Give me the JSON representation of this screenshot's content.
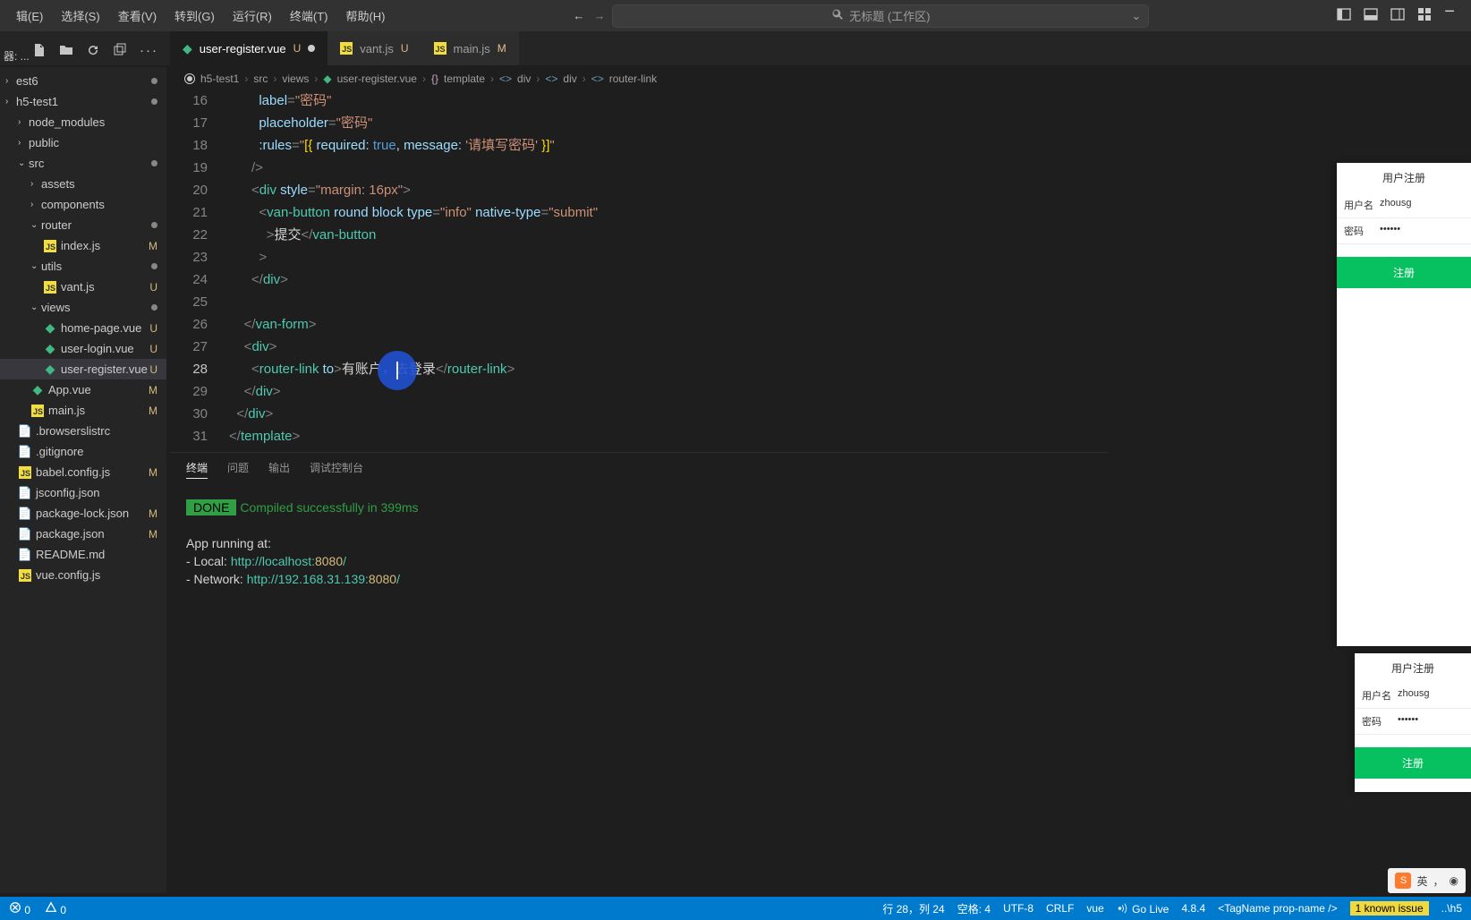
{
  "menubar": {
    "items": [
      "辑(E)",
      "选择(S)",
      "查看(V)",
      "转到(G)",
      "运行(R)",
      "终端(T)",
      "帮助(H)"
    ]
  },
  "search": {
    "label": "无标题 (工作区)"
  },
  "tabs": [
    {
      "icon": "vue",
      "name": "user-register.vue",
      "badge": "U",
      "dirty": true,
      "active": true
    },
    {
      "icon": "js",
      "name": "vant.js",
      "badge": "U",
      "dirty": false,
      "active": false
    },
    {
      "icon": "js",
      "name": "main.js",
      "badge": "M",
      "dirty": false,
      "active": false
    }
  ],
  "side_toolbar_label": "器: ...",
  "breadcrumb": {
    "items": [
      "h5-test1",
      "src",
      "views",
      "user-register.vue",
      "template",
      "div",
      "div",
      "router-link"
    ]
  },
  "tree": [
    {
      "depth": 0,
      "kind": "chev",
      "name": "est6",
      "badge": "dot"
    },
    {
      "depth": 0,
      "kind": "chev",
      "name": "h5-test1",
      "badge": "dot"
    },
    {
      "depth": 1,
      "kind": "chev",
      "name": "node_modules"
    },
    {
      "depth": 1,
      "kind": "chev",
      "name": "public"
    },
    {
      "depth": 1,
      "kind": "chev-open",
      "name": "src",
      "badge": "dot"
    },
    {
      "depth": 2,
      "kind": "chev",
      "name": "assets"
    },
    {
      "depth": 2,
      "kind": "chev",
      "name": "components"
    },
    {
      "depth": 2,
      "kind": "chev-open",
      "name": "router",
      "badge": "dot"
    },
    {
      "depth": 3,
      "kind": "js",
      "name": "index.js",
      "badge": "M"
    },
    {
      "depth": 2,
      "kind": "chev-open",
      "name": "utils",
      "badge": "dot"
    },
    {
      "depth": 3,
      "kind": "js",
      "name": "vant.js",
      "badge": "U"
    },
    {
      "depth": 2,
      "kind": "chev-open",
      "name": "views",
      "badge": "dot"
    },
    {
      "depth": 3,
      "kind": "vue",
      "name": "home-page.vue",
      "badge": "U"
    },
    {
      "depth": 3,
      "kind": "vue",
      "name": "user-login.vue",
      "badge": "U"
    },
    {
      "depth": 3,
      "kind": "vue",
      "name": "user-register.vue",
      "badge": "U",
      "sel": true
    },
    {
      "depth": 2,
      "kind": "vue",
      "name": "App.vue",
      "badge": "M"
    },
    {
      "depth": 2,
      "kind": "js",
      "name": "main.js",
      "badge": "M"
    },
    {
      "depth": 1,
      "kind": "file",
      "name": ".browserslistrc"
    },
    {
      "depth": 1,
      "kind": "file",
      "name": ".gitignore"
    },
    {
      "depth": 1,
      "kind": "js",
      "name": "babel.config.js",
      "badge": "M"
    },
    {
      "depth": 1,
      "kind": "file",
      "name": "jsconfig.json"
    },
    {
      "depth": 1,
      "kind": "file",
      "name": "package-lock.json",
      "badge": "M"
    },
    {
      "depth": 1,
      "kind": "file",
      "name": "package.json",
      "badge": "M"
    },
    {
      "depth": 1,
      "kind": "file",
      "name": "README.md"
    },
    {
      "depth": 1,
      "kind": "js",
      "name": "vue.config.js"
    }
  ],
  "editor": {
    "first_line": 16,
    "active_line": 28,
    "lines": [
      {
        "n": 16,
        "html": "        <span class='tok-attr'>label</span><span class='tok-punct'>=</span><span class='tok-str'>\"密码\"</span>"
      },
      {
        "n": 17,
        "html": "        <span class='tok-attr'>placeholder</span><span class='tok-punct'>=</span><span class='tok-str'>\"密码\"</span>"
      },
      {
        "n": 18,
        "html": "        <span class='tok-attr'>:rules</span><span class='tok-punct'>=</span><span class='tok-str'>\"</span><span class='tok-brace'>[{</span> <span class='tok-attr'>required:</span> <span class='tok-bool'>true</span><span class='tok-text'>,</span> <span class='tok-attr'>message:</span> <span class='tok-str'>'请填写密码'</span> <span class='tok-brace'>}]</span><span class='tok-str'>\"</span>"
      },
      {
        "n": 19,
        "html": "      <span class='tok-punct'>/&gt;</span>"
      },
      {
        "n": 20,
        "html": "      <span class='tok-punct'>&lt;</span><span class='tok-tag'>div</span> <span class='tok-attr'>style</span><span class='tok-punct'>=</span><span class='tok-str'>\"margin: 16px\"</span><span class='tok-punct'>&gt;</span>"
      },
      {
        "n": 21,
        "html": "        <span class='tok-punct'>&lt;</span><span class='tok-tag'>van-button</span> <span class='tok-attr'>round</span> <span class='tok-attr'>block</span> <span class='tok-attr'>type</span><span class='tok-punct'>=</span><span class='tok-str'>\"info\"</span> <span class='tok-attr'>native-type</span><span class='tok-punct'>=</span><span class='tok-str'>\"submit\"</span>"
      },
      {
        "n": 22,
        "html": "          <span class='tok-punct'>&gt;</span><span class='tok-text'>提交</span><span class='tok-punct'>&lt;/</span><span class='tok-tag'>van-button</span>"
      },
      {
        "n": 23,
        "html": "        <span class='tok-punct'>&gt;</span>"
      },
      {
        "n": 24,
        "html": "      <span class='tok-punct'>&lt;/</span><span class='tok-tag'>div</span><span class='tok-punct'>&gt;</span>"
      },
      {
        "n": 25,
        "html": ""
      },
      {
        "n": 26,
        "html": "    <span class='tok-punct'>&lt;/</span><span class='tok-tag'>van-form</span><span class='tok-punct'>&gt;</span>"
      },
      {
        "n": 27,
        "html": "    <span class='tok-punct'>&lt;</span><span class='tok-tag'>div</span><span class='tok-punct'>&gt;</span>"
      },
      {
        "n": 28,
        "html": "      <span class='tok-punct'>&lt;</span><span class='tok-tag'>router-link</span> <span class='tok-attr'>to</span><span class='tok-punct'>&gt;</span><span class='tok-text'>有账户，去登录</span><span class='tok-punct'>&lt;/</span><span class='tok-tag'>router-link</span><span class='tok-punct'>&gt;</span>"
      },
      {
        "n": 29,
        "html": "    <span class='tok-punct'>&lt;/</span><span class='tok-tag'>div</span><span class='tok-punct'>&gt;</span>"
      },
      {
        "n": 30,
        "html": "  <span class='tok-punct'>&lt;/</span><span class='tok-tag'>div</span><span class='tok-punct'>&gt;</span>"
      },
      {
        "n": 31,
        "html": "<span class='tok-punct'>&lt;/</span><span class='tok-tag'>template</span><span class='tok-punct'>&gt;</span>"
      }
    ]
  },
  "panel": {
    "tabs": [
      "终端",
      "问题",
      "输出",
      "调试控制台"
    ],
    "active_tab": 0,
    "done_label": "DONE",
    "done_msg": "Compiled successfully in 399ms",
    "app_running": "App running at:",
    "local_label": "- Local:   ",
    "local_host": "http://localhost:",
    "local_port": "8080",
    "local_tail": "/",
    "network_label": "- Network: ",
    "network_host": "http://192.168.31.139:",
    "network_port": "8080",
    "network_tail": "/"
  },
  "preview": {
    "title": "用户注册",
    "rows": [
      {
        "label": "用户名",
        "value": "zhousg"
      },
      {
        "label": "密码",
        "value": "••••••"
      }
    ],
    "button": "注册"
  },
  "statusbar": {
    "errors": "0",
    "warnings": "0",
    "ln_col": "行 28，列 24",
    "spaces": "空格: 4",
    "encoding": "UTF-8",
    "eol": "CRLF",
    "lang": "vue",
    "golive": "Go Live",
    "version": "4.8.4",
    "tagname": "<TagName prop-name />",
    "issue": "1 known issue",
    "right_tail": "..\\h5"
  },
  "ime": {
    "lang": "英",
    "comma": "，",
    "full": "◉"
  }
}
